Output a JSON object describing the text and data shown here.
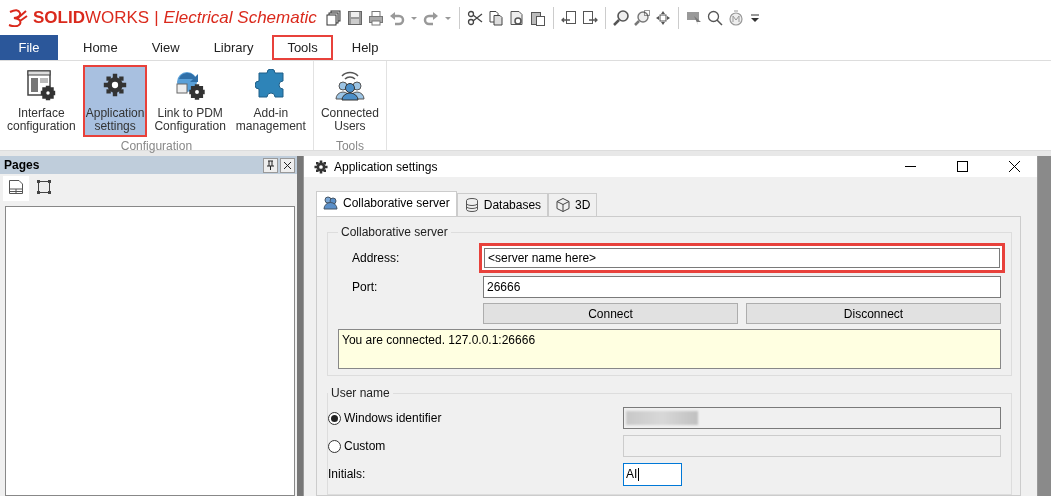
{
  "brand": {
    "bold": "SOLID",
    "rest": "WORKS",
    "separator": "|",
    "product": "Electrical Schematic"
  },
  "menu_tabs": [
    {
      "label": "File",
      "kind": "file",
      "highlighted": false
    },
    {
      "label": "Home",
      "kind": "tab",
      "highlighted": false
    },
    {
      "label": "View",
      "kind": "tab",
      "highlighted": false
    },
    {
      "label": "Library",
      "kind": "tab",
      "highlighted": false
    },
    {
      "label": "Tools",
      "kind": "tab",
      "highlighted": true
    },
    {
      "label": "Help",
      "kind": "tab",
      "highlighted": false
    }
  ],
  "ribbon": {
    "groups": [
      {
        "label": "Configuration",
        "buttons": [
          {
            "lines": [
              "Interface",
              "configuration"
            ],
            "kind": "window-gear",
            "selected": false,
            "highlighted": false
          },
          {
            "lines": [
              "Application",
              "settings"
            ],
            "kind": "gear",
            "selected": true,
            "highlighted": true
          },
          {
            "lines": [
              "Link to PDM",
              "Configuration"
            ],
            "kind": "sync-gear",
            "selected": false,
            "highlighted": false
          },
          {
            "lines": [
              "Add-in",
              "management"
            ],
            "kind": "puzzle",
            "selected": false,
            "highlighted": false
          }
        ]
      },
      {
        "label": "Tools",
        "buttons": [
          {
            "lines": [
              "Connected",
              "Users"
            ],
            "kind": "users",
            "selected": false,
            "highlighted": false
          }
        ]
      }
    ]
  },
  "pages_pane": {
    "title": "Pages",
    "tabs": [
      {
        "kind": "page",
        "selected": true
      },
      {
        "kind": "frame",
        "selected": false
      }
    ]
  },
  "dialog": {
    "title": "Application settings",
    "tabs": [
      {
        "label": "Collaborative server",
        "kind": "users",
        "selected": true
      },
      {
        "label": "Databases",
        "kind": "database",
        "selected": false
      },
      {
        "label": "3D",
        "kind": "cube",
        "selected": false
      }
    ],
    "server_group": {
      "legend": "Collaborative server",
      "fields": [
        {
          "label": "Address:",
          "value": "<server name here>",
          "highlighted": true
        },
        {
          "label": "Port:",
          "value": "26666",
          "highlighted": false
        }
      ],
      "buttons": [
        "Connect",
        "Disconnect"
      ],
      "status": "You are connected. 127.0.0.1:26666"
    },
    "user_group": {
      "legend": "User name",
      "options": [
        {
          "label": "Windows identifier",
          "selected": true,
          "disabled": false,
          "redacted": true
        },
        {
          "label": "Custom",
          "selected": false,
          "disabled": true,
          "redacted": false
        }
      ],
      "initials": {
        "label": "Initials:",
        "value": "AI",
        "focused": true
      }
    }
  }
}
